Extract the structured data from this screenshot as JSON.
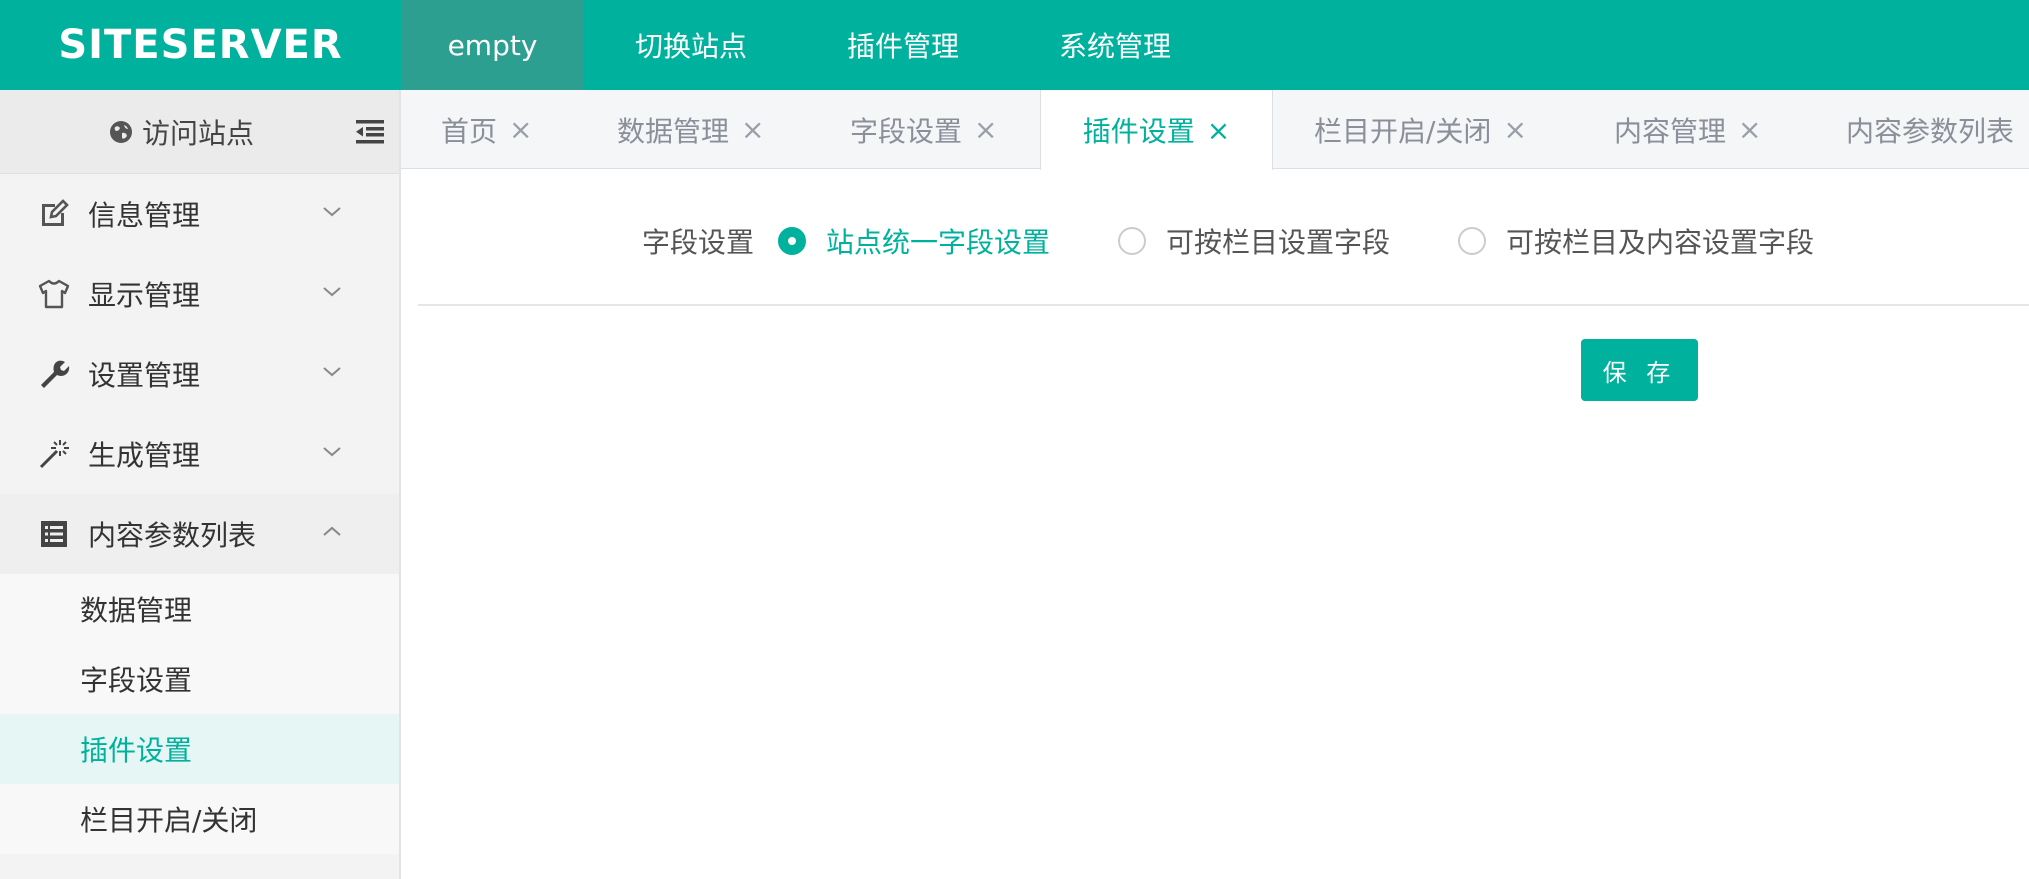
{
  "header": {
    "logo": "SITESERVER",
    "nav": [
      {
        "label": "empty",
        "active": true
      },
      {
        "label": "切换站点",
        "active": false
      },
      {
        "label": "插件管理",
        "active": false
      },
      {
        "label": "系统管理",
        "active": false
      }
    ]
  },
  "sidebar": {
    "visit_label": "访问站点",
    "menu": [
      {
        "label": "信息管理",
        "icon": "edit-icon",
        "expanded": false
      },
      {
        "label": "显示管理",
        "icon": "tshirt-icon",
        "expanded": false
      },
      {
        "label": "设置管理",
        "icon": "wrench-icon",
        "expanded": false
      },
      {
        "label": "生成管理",
        "icon": "magic-wand-icon",
        "expanded": false
      },
      {
        "label": "内容参数列表",
        "icon": "list-icon",
        "expanded": true
      }
    ],
    "submenu": [
      {
        "label": "数据管理",
        "active": false
      },
      {
        "label": "字段设置",
        "active": false
      },
      {
        "label": "插件设置",
        "active": true
      },
      {
        "label": "栏目开启/关闭",
        "active": false
      }
    ]
  },
  "tabs": [
    {
      "label": "首页",
      "closable": true,
      "active": false
    },
    {
      "label": "数据管理",
      "closable": true,
      "active": false
    },
    {
      "label": "字段设置",
      "closable": true,
      "active": false
    },
    {
      "label": "插件设置",
      "closable": true,
      "active": true
    },
    {
      "label": "栏目开启/关闭",
      "closable": true,
      "active": false
    },
    {
      "label": "内容管理",
      "closable": true,
      "active": false
    },
    {
      "label": "内容参数列表",
      "closable": false,
      "active": false
    }
  ],
  "tab_close_glyph": "×",
  "form": {
    "label": "字段设置",
    "options": [
      {
        "label": "站点统一字段设置",
        "checked": true
      },
      {
        "label": "可按栏目设置字段",
        "checked": false
      },
      {
        "label": "可按栏目及内容设置字段",
        "checked": false
      }
    ]
  },
  "save_label": "保 存",
  "colors": {
    "brand": "#00b19d",
    "active_nav": "#2d9f91",
    "sidebar_bg": "#f3f3f3",
    "active_sub_bg": "#e6f6f4"
  }
}
